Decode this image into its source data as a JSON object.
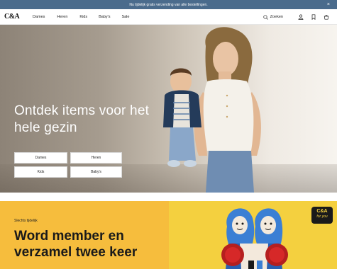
{
  "promo_bar": {
    "text": "Nu tijdelijk gratis verzending van alle bestellingen."
  },
  "header": {
    "logo": "C&A",
    "nav": [
      "Dames",
      "Heren",
      "Kids",
      "Baby's",
      "Sale"
    ],
    "search_label": "Zoeken"
  },
  "hero": {
    "title": "Ontdek items voor het hele gezin",
    "buttons": [
      "Dames",
      "Heren",
      "Kids",
      "Baby's"
    ]
  },
  "member": {
    "kicker": "Slechts tijdelijk",
    "title": "Word member en verzamel twee keer",
    "badge_line1": "C&A",
    "badge_line2": "for you"
  },
  "colors": {
    "promo_bg": "#4a6b8c",
    "member_left": "#f6bd3d",
    "member_right": "#f4d03f",
    "character_blue": "#3b7fd4",
    "character_red": "#d62828"
  }
}
